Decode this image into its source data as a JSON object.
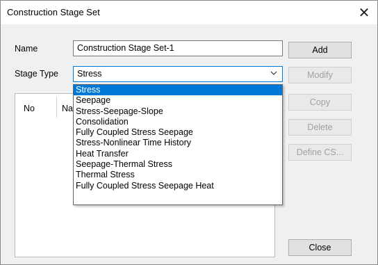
{
  "window": {
    "title": "Construction Stage Set",
    "close_glyph": "✕"
  },
  "form": {
    "name_label": "Name",
    "name_value": "Construction Stage Set-1",
    "stage_type_label": "Stage Type",
    "stage_type_value": "Stress"
  },
  "list": {
    "col_no": "No",
    "col_name_partial": "Na"
  },
  "dropdown": {
    "options": [
      "Stress",
      "Seepage",
      "Stress-Seepage-Slope",
      "Consolidation",
      "Fully Coupled Stress Seepage",
      "Stress-Nonlinear Time History",
      "Heat Transfer",
      "Seepage-Thermal Stress",
      "Thermal Stress",
      "Fully Coupled Stress Seepage Heat"
    ],
    "selected_index": 0
  },
  "buttons": {
    "add": "Add",
    "modify": "Modify",
    "copy": "Copy",
    "delete": "Delete",
    "define_cs": "Define CS...",
    "close": "Close"
  },
  "icons": {
    "close": "close-icon",
    "chevron": "chevron-down-icon"
  }
}
